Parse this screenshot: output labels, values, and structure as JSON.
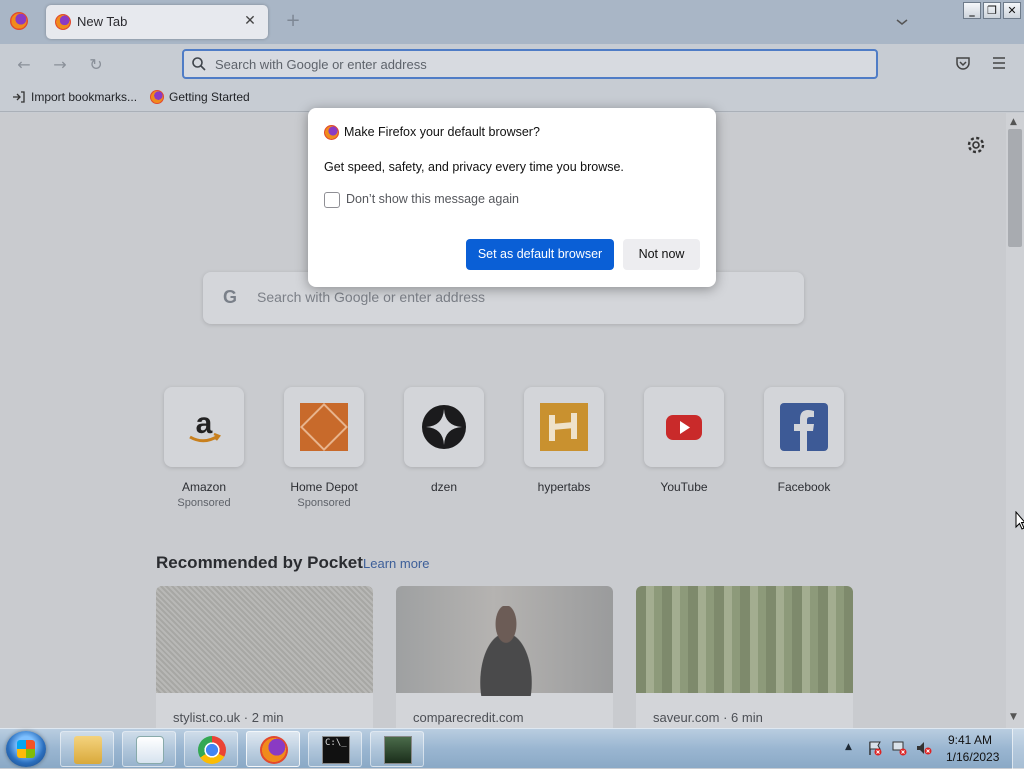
{
  "window": {
    "tab_title": "New Tab",
    "tab_close": "✕",
    "new_tab": "+",
    "tab_list": "⌄",
    "min": "_",
    "max": "❐",
    "close": "✕"
  },
  "nav": {
    "back": "←",
    "forward": "→",
    "reload": "↻",
    "url_placeholder": "Search with Google or enter address"
  },
  "bookmarks": {
    "items": [
      {
        "label": "Import bookmarks...",
        "icon": "import-icon"
      },
      {
        "label": "Getting Started",
        "icon": "firefox-icon"
      }
    ]
  },
  "newtab": {
    "search_placeholder": "Search with Google or enter address",
    "search_logo": "G",
    "top_sites": [
      {
        "name": "Amazon",
        "sponsored": "Sponsored",
        "icon": "amazon-logo"
      },
      {
        "name": "Home Depot",
        "sponsored": "Sponsored",
        "icon": "home-depot-logo"
      },
      {
        "name": "dzen",
        "sponsored": "",
        "icon": "dzen-logo"
      },
      {
        "name": "hypertabs",
        "sponsored": "",
        "icon": "hypertabs-logo"
      },
      {
        "name": "YouTube",
        "sponsored": "",
        "icon": "youtube-logo"
      },
      {
        "name": "Facebook",
        "sponsored": "",
        "icon": "facebook-logo"
      }
    ],
    "pocket_heading": "Recommended by Pocket",
    "learn_more": "Learn more",
    "cards": [
      {
        "source": "stylist.co.uk · 2 min"
      },
      {
        "source": "comparecredit.com"
      },
      {
        "source": "saveur.com · 6 min"
      }
    ]
  },
  "dialog": {
    "title": "Make Firefox your default browser?",
    "body": "Get speed, safety, and privacy every time you browse.",
    "checkbox_label": "Don’t show this message again",
    "primary_button": "Set as default browser",
    "secondary_button": "Not now"
  },
  "taskbar": {
    "apps": [
      "explorer-icon",
      "media-player-icon",
      "chrome-icon",
      "firefox-icon",
      "cmd-icon",
      "task-manager-icon"
    ],
    "cmd_text": "C:\\_",
    "tray_arrow": "▲",
    "time": "9:41 AM",
    "date": "1/16/2023"
  },
  "colors": {
    "accent": "#0a5fd6",
    "urlbar_border": "#4f7cc6",
    "taskbar": "#9ab6d1"
  }
}
